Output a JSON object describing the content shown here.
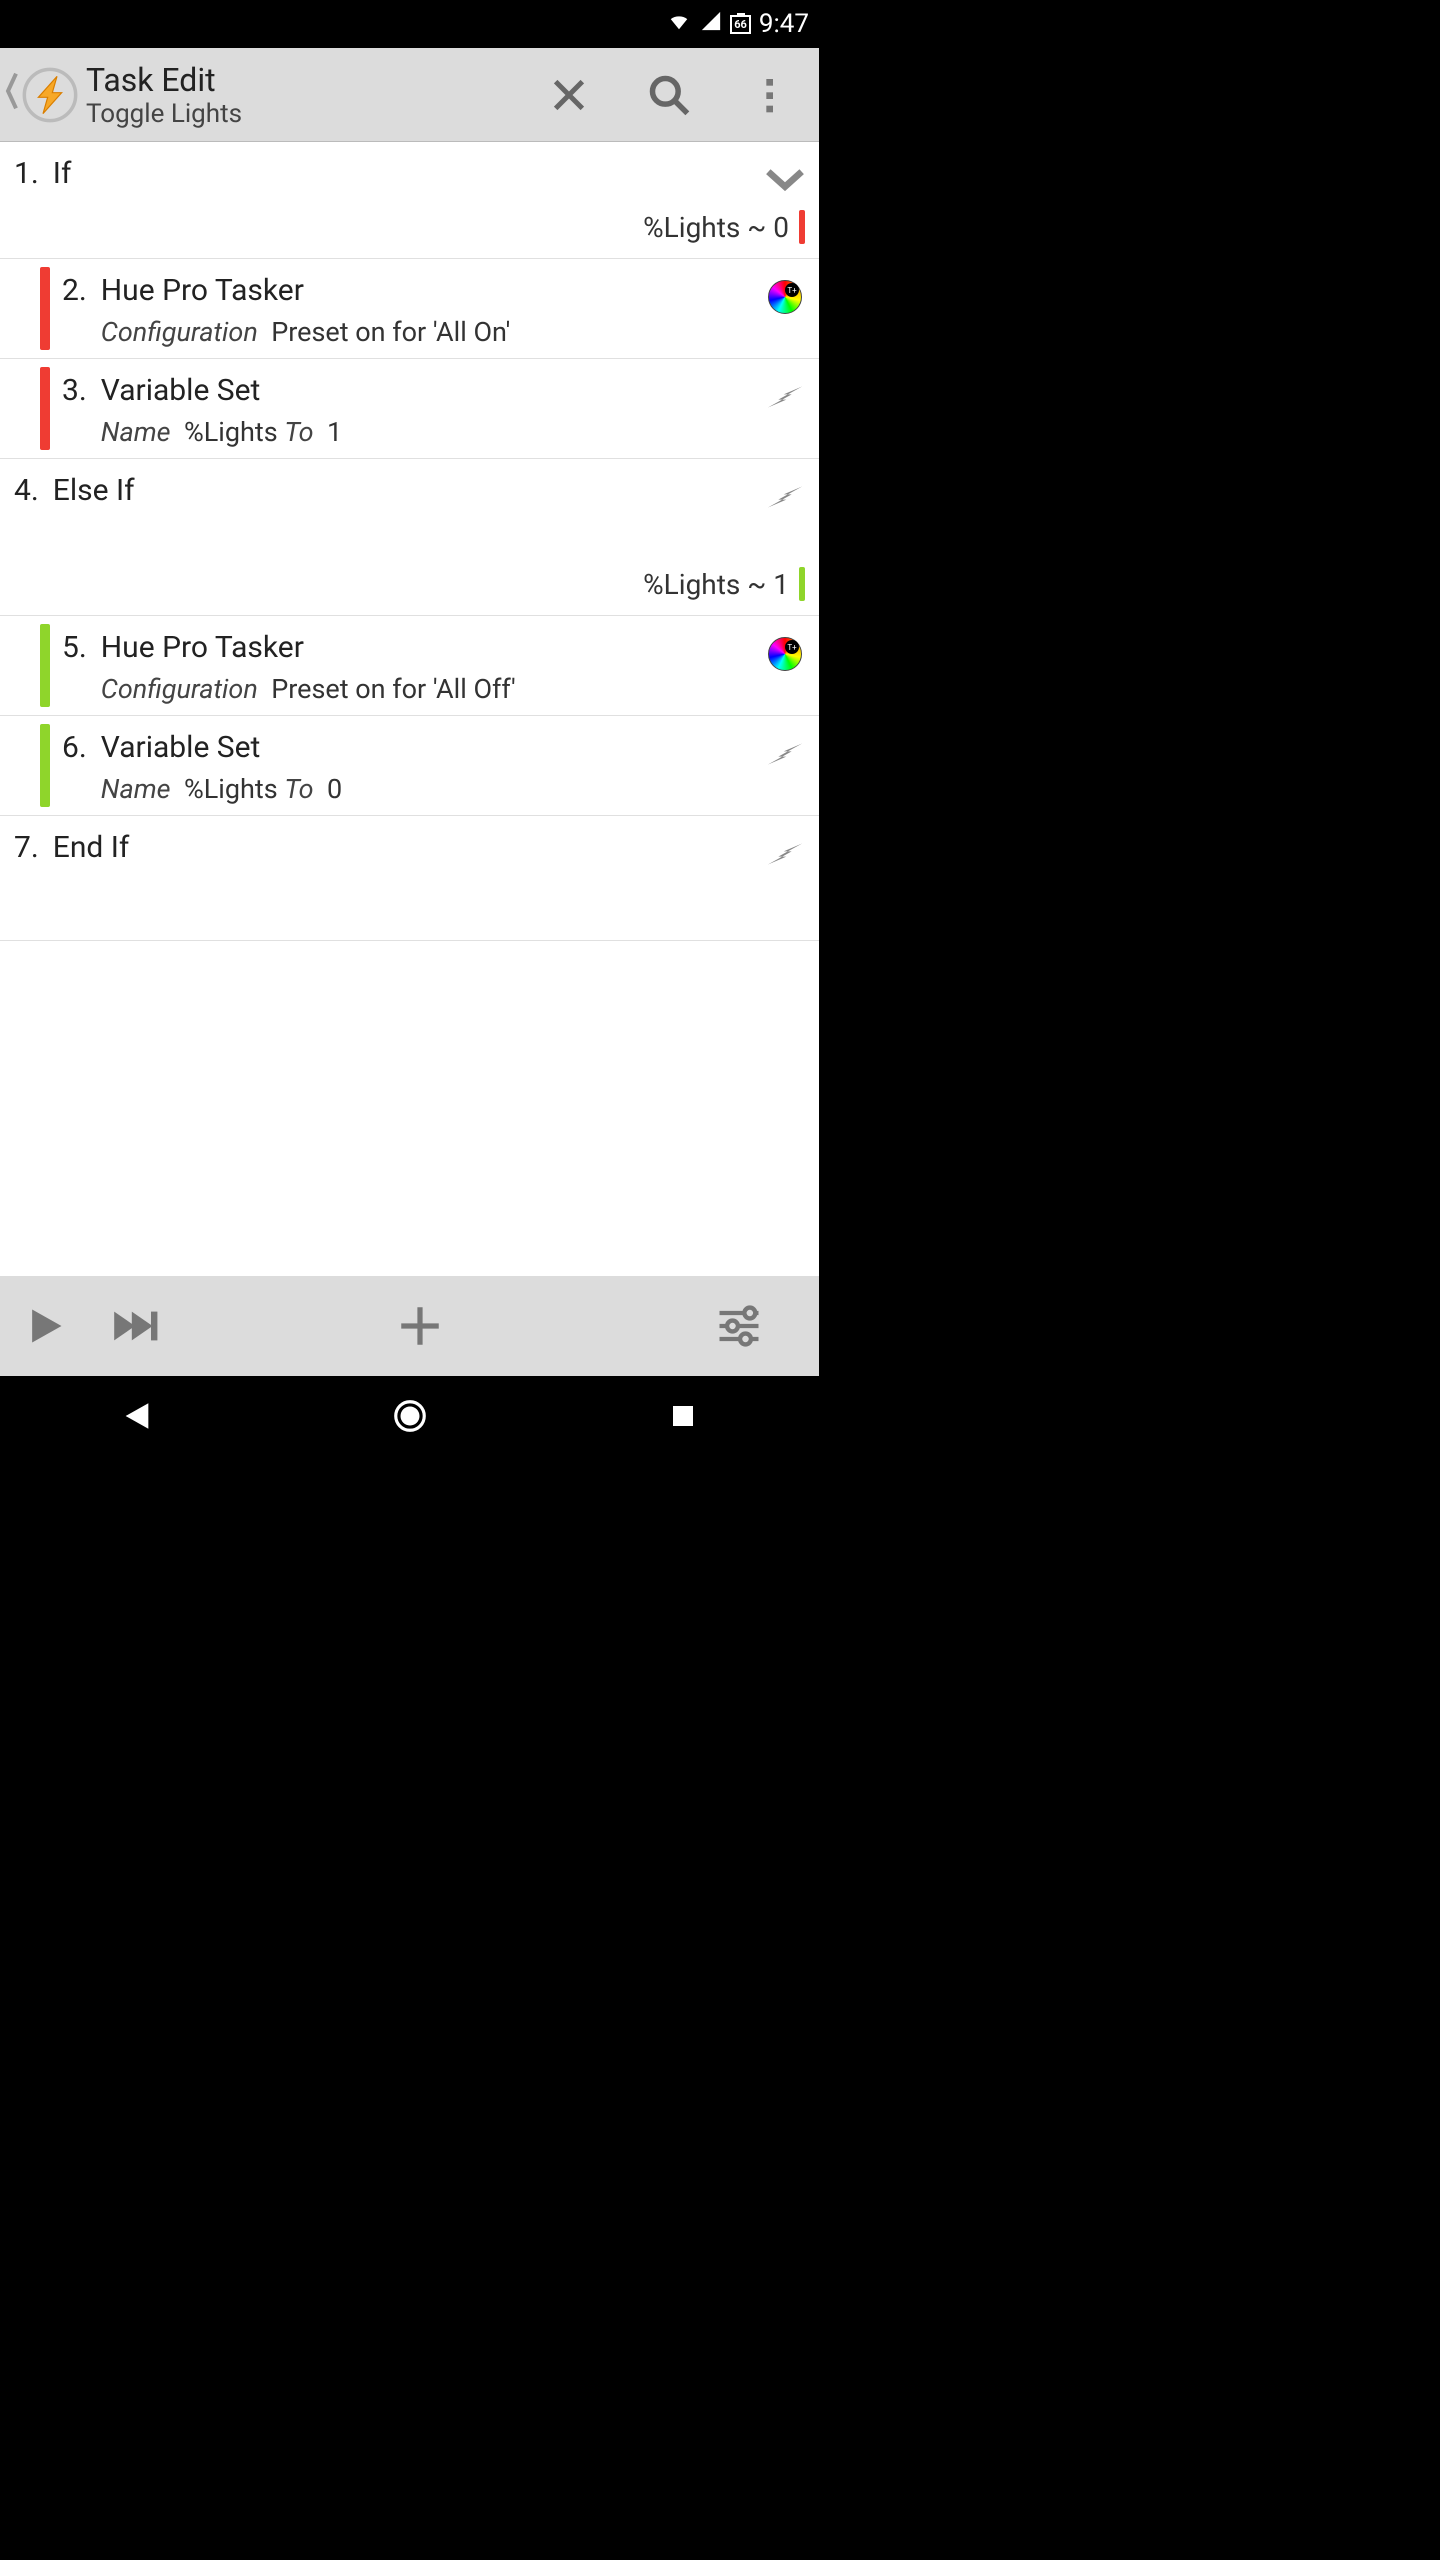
{
  "status": {
    "battery": "66",
    "time": "9:47"
  },
  "header": {
    "title": "Task Edit",
    "subtitle": "Toggle Lights"
  },
  "actions": [
    {
      "num": "1.",
      "title": "If",
      "condition_text": "%Lights ~ 0",
      "condition_color": "red",
      "end_icon": "chevron-down",
      "indent": 0
    },
    {
      "num": "2.",
      "title": "Hue Pro Tasker",
      "detail_label": "Configuration",
      "detail_value": "Preset on for 'All On'",
      "end_icon": "hue",
      "indent": 1,
      "indent_color": "red"
    },
    {
      "num": "3.",
      "title": "Variable Set",
      "detail_parts": [
        {
          "label": "Name",
          "value": "%Lights"
        },
        {
          "label": "To",
          "value": "1"
        }
      ],
      "end_icon": "bolt",
      "indent": 1,
      "indent_color": "red"
    },
    {
      "num": "4.",
      "title": "Else If",
      "condition_text": "%Lights ~ 1",
      "condition_color": "green",
      "end_icon": "bolt",
      "indent": 0
    },
    {
      "num": "5.",
      "title": "Hue Pro Tasker",
      "detail_label": "Configuration",
      "detail_value": "Preset on for 'All Off'",
      "end_icon": "hue",
      "indent": 1,
      "indent_color": "green"
    },
    {
      "num": "6.",
      "title": "Variable Set",
      "detail_parts": [
        {
          "label": "Name",
          "value": "%Lights"
        },
        {
          "label": "To",
          "value": "0"
        }
      ],
      "end_icon": "bolt",
      "indent": 1,
      "indent_color": "green"
    },
    {
      "num": "7.",
      "title": "End If",
      "end_icon": "bolt",
      "indent": 0,
      "tall": true
    }
  ]
}
